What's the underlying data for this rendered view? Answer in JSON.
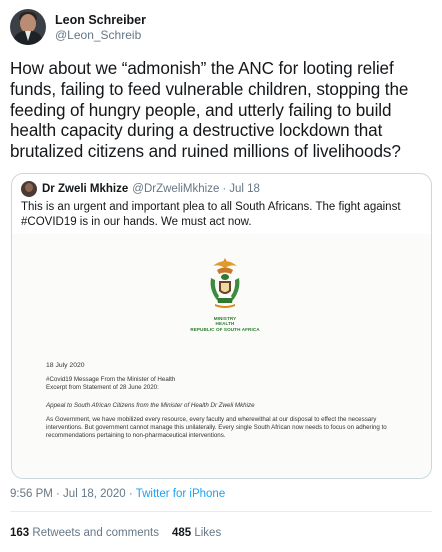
{
  "author": {
    "display_name": "Leon Schreiber",
    "handle": "@Leon_Schreib"
  },
  "tweet": {
    "text": "How about we “admonish” the ANC for looting relief funds, failing to feed vulnerable children, stopping the feeding of hungry people, and utterly failing to build health capacity during a destructive lockdown that brutalized citizens and ruined millions of livelihoods?"
  },
  "quoted_tweet": {
    "display_name": "Dr Zweli Mkhize",
    "handle": "@DrZweliMkhize",
    "separator": "·",
    "time": "Jul 18",
    "text": "This is an urgent and important plea to all South Africans. The fight against #COVID19 is in our hands. We must act now.",
    "document": {
      "ministry_lines": [
        "MINISTRY",
        "HEALTH",
        "REPUBLIC OF SOUTH AFRICA"
      ],
      "date": "18 July 2020",
      "message_line1": "#Covid19 Message From the Minister of Health",
      "message_line2": "Excerpt from Statement of 28 June 2020:",
      "appeal": "Appeal to South African Citizens from the Minister of Health Dr Zweli Mkhize",
      "body": "As Government, we have mobilized every resource, every faculty and wherewithal at our disposal to effect the necessary interventions. But government cannot manage this unilaterally. Every single South African now needs to focus on adhering to recommendations pertaining to non-pharmaceutical interventions."
    }
  },
  "meta": {
    "timestamp": "9:56 PM · Jul 18, 2020 · ",
    "source": "Twitter for iPhone"
  },
  "stats": {
    "retweets_count": "163",
    "retweets_label": "Retweets and comments",
    "likes_count": "485",
    "likes_label": "Likes"
  },
  "colors": {
    "link": "#1da1f2",
    "secondary_text": "#657786",
    "border": "#ccd6dd"
  }
}
